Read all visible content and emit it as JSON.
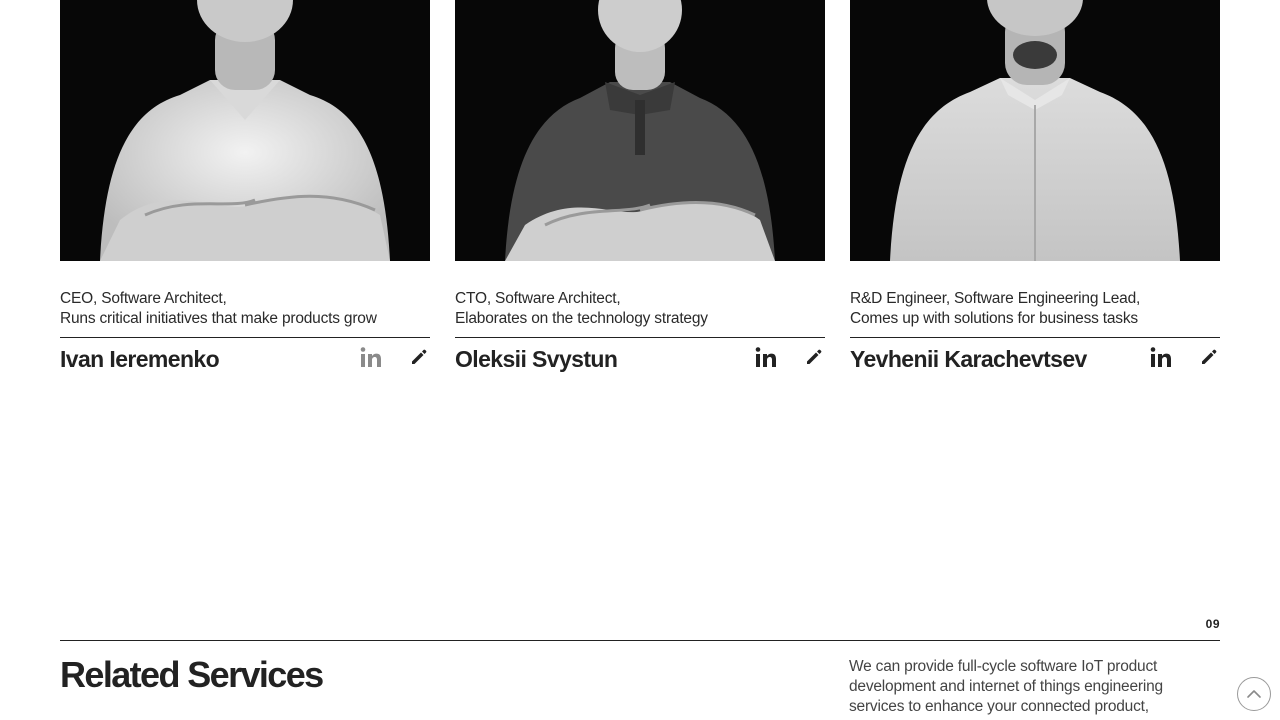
{
  "team": [
    {
      "role_line1": "CEO, Software Architect,",
      "role_line2": "Runs critical initiatives that make products grow",
      "name": "Ivan Ieremenko",
      "shirt": "white-tshirt"
    },
    {
      "role_line1": "CTO, Software Architect,",
      "role_line2": "Elaborates on the technology strategy",
      "name": "Oleksii Svystun",
      "shirt": "dark-polo"
    },
    {
      "role_line1": "R&D Engineer, Software Engineering Lead,",
      "role_line2": "Comes up with solutions for business tasks",
      "name": "Yevhenii Karachevtsev",
      "shirt": "light-dress-shirt"
    }
  ],
  "icons": {
    "linkedin": "linkedin-icon",
    "edit": "pencil-icon",
    "scroll_top": "chevron-up-icon"
  },
  "section": {
    "number": "09",
    "title": "Related Services",
    "description": "We can provide full-cycle software IoT product development and internet of things engineering services to enhance your connected product,"
  },
  "colors": {
    "text": "#222222",
    "photo_bg": "#0a0a0a"
  }
}
